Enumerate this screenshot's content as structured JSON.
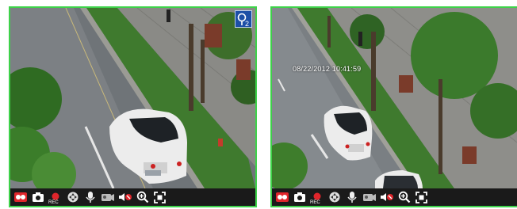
{
  "cameras": [
    {
      "id_label": "",
      "timestamp": "",
      "badge": "ptz-2-icon",
      "toolbar": [
        "stream-icon",
        "snapshot-icon",
        "record-icon",
        "ptz-icon",
        "intercom-icon",
        "audio-icon",
        "mute-icon",
        "zoom-icon",
        "fullscreen-icon"
      ],
      "rec_label": "REC"
    },
    {
      "timestamp": "08/22/2012  10:41:59",
      "toolbar": [
        "stream-icon",
        "snapshot-icon",
        "record-icon",
        "ptz-icon",
        "intercom-icon",
        "audio-icon",
        "mute-icon",
        "zoom-icon",
        "fullscreen-icon"
      ],
      "rec_label": "REC"
    }
  ],
  "colors": {
    "frame_border": "#3ed24a",
    "toolbar_bg": "#1a1a1a",
    "record_red": "#e0252b",
    "badge_blue": "#1d4fa6"
  }
}
